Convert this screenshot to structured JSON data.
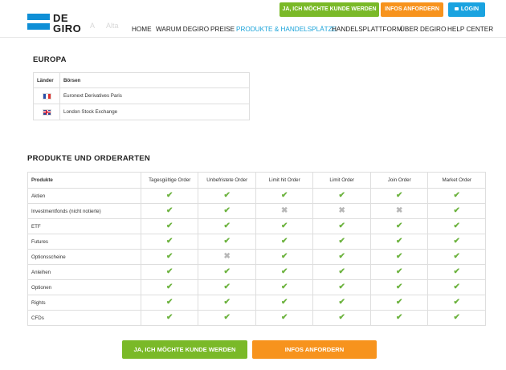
{
  "header": {
    "logo_line1": "DE",
    "logo_line2": "GIRO",
    "top_buttons": {
      "signup": "JA, ICH MÖCHTE KUNDE WERDEN",
      "info": "INFOS ANFORDERN",
      "login": "LOGIN"
    },
    "ghost_text": [
      "A",
      "Alta"
    ],
    "nav": [
      "HOME",
      "WARUM DEGIRO",
      "PREISE",
      "PRODUKTE & HANDELSPLÄTZE",
      "HANDELSPLATTFORM",
      "ÜBER DEGIRO",
      "HELP CENTER"
    ],
    "active_nav": "PRODUKTE & HANDELSPLÄTZE"
  },
  "europe": {
    "title": "EUROPA",
    "columns": [
      "Länder",
      "Börsen"
    ],
    "rows": [
      {
        "flag": "france-flag-icon",
        "exchange": "Euronext Derivatives Paris"
      },
      {
        "flag": "uk-flag-icon",
        "exchange": "London Stock Exchange"
      }
    ]
  },
  "products": {
    "title": "PRODUKTE UND ORDERARTEN",
    "columns": [
      "Produkte",
      "Tagesgültige Order",
      "Unbefristete Order",
      "Limit hit Order",
      "Limit Order",
      "Join Order",
      "Market Order"
    ],
    "rows": [
      {
        "name": "Aktien",
        "cells": [
          true,
          true,
          true,
          true,
          true,
          true
        ]
      },
      {
        "name": "Investmentfonds (nicht notierte)",
        "cells": [
          true,
          true,
          false,
          false,
          false,
          true
        ]
      },
      {
        "name": "ETF",
        "cells": [
          true,
          true,
          true,
          true,
          true,
          true
        ]
      },
      {
        "name": "Futures",
        "cells": [
          true,
          true,
          true,
          true,
          true,
          true
        ]
      },
      {
        "name": "Optionsscheine",
        "cells": [
          true,
          false,
          true,
          true,
          true,
          true
        ]
      },
      {
        "name": "Anleihen",
        "cells": [
          true,
          true,
          true,
          true,
          true,
          true
        ]
      },
      {
        "name": "Optionen",
        "cells": [
          true,
          true,
          true,
          true,
          true,
          true
        ]
      },
      {
        "name": "Rights",
        "cells": [
          true,
          true,
          true,
          true,
          true,
          true
        ]
      },
      {
        "name": "CFDs",
        "cells": [
          true,
          true,
          true,
          true,
          true,
          true
        ]
      }
    ]
  },
  "bottom_buttons": {
    "signup": "JA, ICH MÖCHTE KUNDE WERDEN",
    "info": "INFOS ANFORDERN"
  },
  "colors": {
    "green": "#7ab928",
    "orange": "#f7931d",
    "blue": "#1aa3e0",
    "check": "#6db33f",
    "cross": "#b8b8b8"
  }
}
